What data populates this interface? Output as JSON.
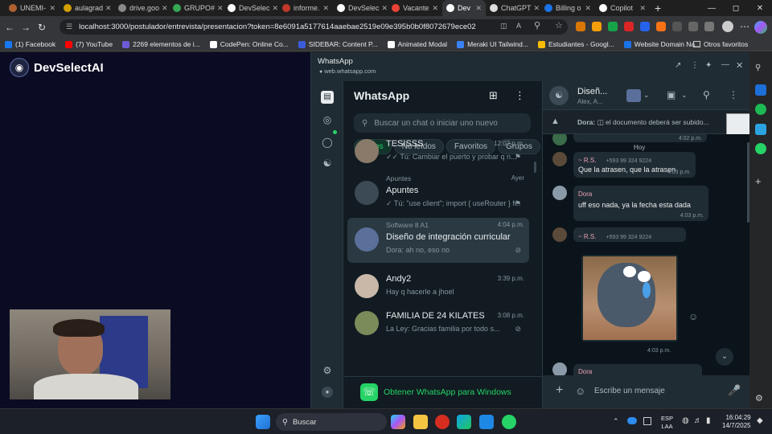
{
  "browser": {
    "tabs": [
      {
        "label": "UNEMI-",
        "color": "#b06030",
        "active": false
      },
      {
        "label": "aulagrad",
        "color": "#d4a000",
        "active": false
      },
      {
        "label": "drive.goo",
        "color": "#888888",
        "active": false
      },
      {
        "label": "GRUPO#",
        "color": "#34a853",
        "active": false
      },
      {
        "label": "DevSelec",
        "color": "#ffffff",
        "active": false
      },
      {
        "label": "informe.",
        "color": "#c0392b",
        "active": false
      },
      {
        "label": "DevSelec",
        "color": "#ffffff",
        "active": false
      },
      {
        "label": "Vacante",
        "color": "#ea4335",
        "active": false
      },
      {
        "label": "Dev",
        "color": "#ffffff",
        "active": true
      },
      {
        "label": "ChatGPT",
        "color": "#dddddd",
        "active": false
      },
      {
        "label": "Billing o",
        "color": "#1a73e8",
        "active": false
      },
      {
        "label": "Copilot",
        "color": "#ffffff",
        "active": false
      }
    ],
    "url": "localhost:3000/postulador/entrevista/presentacion?token=8e6091a5177614aaebae2519e09e395b0b0f8072679ece02",
    "bookmarks": [
      {
        "label": "(1) Facebook",
        "color": "#1877f2"
      },
      {
        "label": "(7) YouTube",
        "color": "#ff0000"
      },
      {
        "label": "2269 elementos de i...",
        "color": "#6b5bd6"
      },
      {
        "label": "CodePen: Online Co...",
        "color": "#ffffff"
      },
      {
        "label": "SIDEBAR: Content P...",
        "color": "#3b5bdb"
      },
      {
        "label": "Animated Modal",
        "color": "#ffffff"
      },
      {
        "label": "Meraki UI Tailwind...",
        "color": "#3b82f6"
      },
      {
        "label": "Estudiantes - Googl...",
        "color": "#fbbc04"
      },
      {
        "label": "Website Domain Na...",
        "color": "#1a73e8"
      }
    ],
    "other_bookmarks": "Otros favoritos"
  },
  "page": {
    "brand": "DevSelectAI"
  },
  "whatsapp": {
    "window_title": "WhatsApp",
    "window_url": "web.whatsapp.com",
    "panel_title": "WhatsApp",
    "search_placeholder": "Buscar un chat o iniciar uno nuevo",
    "filters": [
      "Todos",
      "No leídos",
      "Favoritos",
      "Grupos"
    ],
    "chats": [
      {
        "name": "TESISSS",
        "preview": "✓✓ Tú: Cambiar el puerto y probar q n...",
        "time": "12:02 p.m.",
        "group": "",
        "icon": "pin-icon",
        "avatar": "#8a7a6a"
      },
      {
        "name": "Apuntes",
        "preview": "✓ Tú: \"use client\"; import { useRouter } fr...",
        "time": "Ayer",
        "group": "Apuntes",
        "icon": "pin-icon",
        "avatar": "#3b4a54"
      },
      {
        "name": "Diseño de integración curricular",
        "preview": "Dora: ah no, eso no",
        "time": "4:04 p.m.",
        "group": "Software 8 A1",
        "icon": "mute-icon",
        "avatar": "#5a6f9a"
      },
      {
        "name": "Andy2",
        "preview": "Hay q hacerle a jhoel",
        "time": "3:39 p.m.",
        "group": "",
        "icon": "",
        "avatar": "#c9b7a8"
      },
      {
        "name": "FAMILIA DE 24 KILATES",
        "preview": "La Ley: Gracias familia por todo s...",
        "time": "3:08 p.m.",
        "group": "",
        "icon": "mute-icon",
        "avatar": "#7a8c5a"
      }
    ],
    "promo": "Obtener WhatsApp para Windows",
    "chat": {
      "title": "Diseñ...",
      "subtitle": "Alex, A...",
      "pinned_sender": "Dora:",
      "pinned_text": "el documento deberá ser subido...",
      "date_chip": "Hoy",
      "messages": [
        {
          "sender": "~ R.S.",
          "phone": "+593 99 324 9224",
          "text": "Que la atrasen, que la atrasen",
          "time": "4:03 p.m."
        },
        {
          "sender": "Dora",
          "phone": "",
          "text": "uff eso nada, ya la fecha esta dada",
          "time": "4:03 p.m."
        },
        {
          "sender": "~ R.S.",
          "phone": "+593 99 324 9224",
          "text": "",
          "time": "4:03 p.m."
        },
        {
          "sender": "Dora",
          "phone": "",
          "text": "",
          "time": ""
        }
      ],
      "top_time": "4:02 p.m.",
      "composer_placeholder": "Escribe un mensaje"
    }
  },
  "taskbar": {
    "search": "Buscar",
    "lang": "ESP",
    "lang2": "LAA",
    "time": "16:04:29",
    "date": "14/7/2025"
  }
}
